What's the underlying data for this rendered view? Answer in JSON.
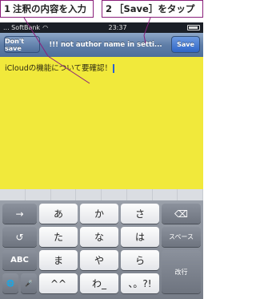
{
  "callouts": [
    {
      "num": "1",
      "text": "注釈の内容を入力"
    },
    {
      "num": "2",
      "text": "［Save］をタップ"
    }
  ],
  "status_bar": {
    "carrier": "... SoftBank",
    "time": "23:37"
  },
  "nav": {
    "cancel_label": "Don't save",
    "title": "!!! not author name in setti...",
    "save_label": "Save"
  },
  "note": {
    "text": "iCloudの機能について要確認！",
    "background": "#f1e93b"
  },
  "keyboard": {
    "rows": [
      [
        "→",
        "あ",
        "か",
        "さ",
        "⌫"
      ],
      [
        "↺",
        "た",
        "な",
        "は",
        "スペース"
      ],
      [
        "ABC",
        "ま",
        "や",
        "ら",
        "改行"
      ],
      [
        "🌐",
        "🎤",
        "^^",
        "わ_",
        "、。?!"
      ]
    ]
  },
  "colors": {
    "callout_border": "#8a1f7a",
    "note": "#f1e93b",
    "nav": "#5f7ea8"
  }
}
